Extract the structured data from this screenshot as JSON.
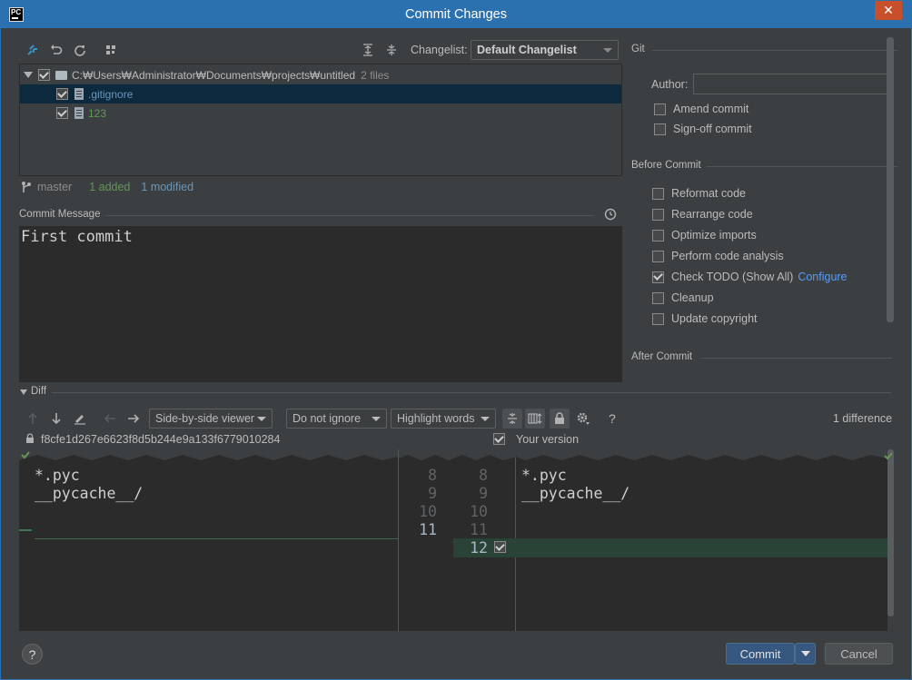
{
  "window": {
    "title": "Commit Changes",
    "app_icon": "PC",
    "close_glyph": "✕"
  },
  "toolbar": {
    "changelist_label": "Changelist:",
    "changelist_value": "Default Changelist"
  },
  "tree": {
    "root_path": "C:₩Users₩Administrator₩Documents₩projects₩untitled",
    "root_count": "2 files",
    "files": [
      {
        "name": ".gitignore",
        "color": "#6897bb",
        "checked": true
      },
      {
        "name": "123",
        "color": "#629755",
        "checked": true
      }
    ]
  },
  "status": {
    "branch": "master",
    "added": "1 added",
    "modified": "1 modified",
    "added_color": "#629755",
    "modified_color": "#6897bb"
  },
  "commit_message": {
    "label": "Commit Message",
    "text": "First commit"
  },
  "git": {
    "section": "Git",
    "author_label": "Author:",
    "author_value": "",
    "amend": "Amend commit",
    "signoff": "Sign-off commit"
  },
  "before_commit": {
    "section": "Before Commit",
    "reformat": "Reformat code",
    "rearrange": "Rearrange code",
    "optimize": "Optimize imports",
    "analysis": "Perform code analysis",
    "todo": "Check TODO (Show All)",
    "configure": "Configure",
    "cleanup": "Cleanup",
    "copyright": "Update copyright"
  },
  "after_commit": {
    "section": "After Commit"
  },
  "diff": {
    "section": "Diff",
    "viewer": "Side-by-side viewer",
    "ignore": "Do not ignore",
    "highlight": "Highlight words",
    "help": "?",
    "count": "1 difference",
    "left_title": "f8cfe1d267e6623f8d5b244e9a133f6779010284",
    "right_title": "Your version",
    "left_lines": [
      "*.pyc",
      "__pycache__/"
    ],
    "right_lines": [
      "*.pyc",
      "__pycache__/"
    ],
    "left_numbers": [
      "8",
      "9",
      "10",
      "11"
    ],
    "right_numbers": [
      "8",
      "9",
      "10",
      "11",
      "12"
    ]
  },
  "buttons": {
    "commit": "Commit",
    "cancel": "Cancel",
    "help": "?"
  }
}
